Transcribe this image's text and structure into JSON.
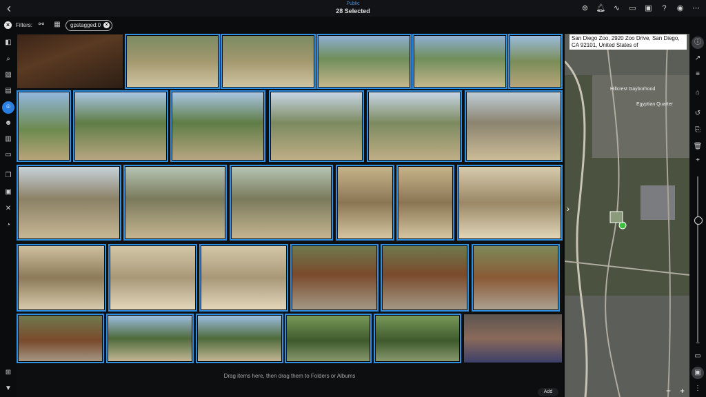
{
  "header": {
    "subtitle": "Public",
    "title": "28 Selected",
    "icons": [
      "plus-circle-icon",
      "bell-icon",
      "activity-icon",
      "cast-icon",
      "window-icon",
      "help-icon",
      "account-icon",
      "more-icon"
    ]
  },
  "filters": {
    "label": "Filters:",
    "chip": "gpstagged:0"
  },
  "dropzone": {
    "text": "Drag items here, then drag them to Folders or Albums",
    "add_label": "Add"
  },
  "map": {
    "address": "San Diego Zoo, 2920 Zoo Drive, San Diego, CA 92101, United States of",
    "labels": [
      "Hillcrest Gayborhood",
      "Egyptian Quarter"
    ]
  },
  "colors": {
    "accent": "#2a7de1",
    "selection_border": "#2f8fe0"
  }
}
